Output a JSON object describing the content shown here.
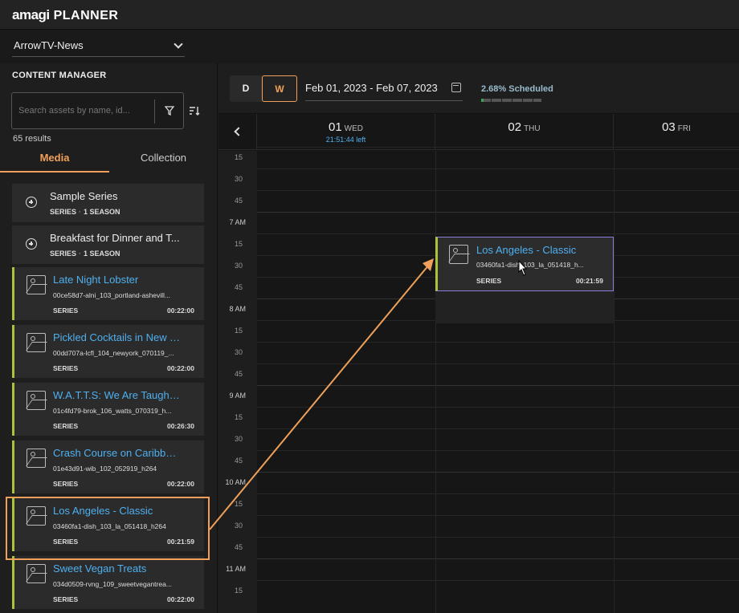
{
  "app": {
    "logo_brand": "amagi",
    "logo_product": "PLANNER",
    "channel": "ArrowTV-News"
  },
  "content_manager": {
    "title": "CONTENT MANAGER",
    "search_placeholder": "Search assets by name, id...",
    "results": "65 results",
    "tabs": {
      "media": "Media",
      "collection": "Collection"
    },
    "series": [
      {
        "title": "Sample Series",
        "type": "SERIES",
        "seasons": "1 SEASON"
      },
      {
        "title": "Breakfast for Dinner and T...",
        "type": "SERIES",
        "seasons": "1 SEASON"
      }
    ],
    "assets": [
      {
        "title": "Late Night Lobster",
        "file": "00ce58d7-alni_103_portland-ashevill...",
        "type": "SERIES",
        "duration": "00:22:00"
      },
      {
        "title": "Pickled Cocktails in New Y...",
        "file": "00dd707a-lcfl_104_newyork_070119_...",
        "type": "SERIES",
        "duration": "00:22:00"
      },
      {
        "title": "W.A.T.T.S: We Are Taught ...",
        "file": "01c4fd79-brok_106_watts_070319_h...",
        "type": "SERIES",
        "duration": "00:26:30"
      },
      {
        "title": "Crash Course on Caribbea...",
        "file": "01e43d91-wib_102_052919_h264",
        "type": "SERIES",
        "duration": "00:22:00"
      },
      {
        "title": "Los Angeles - Classic",
        "file": "03460fa1-dish_103_la_051418_h264",
        "type": "SERIES",
        "duration": "00:21:59"
      },
      {
        "title": "Sweet Vegan Treats",
        "file": "034d0509-rvng_109_sweetvegantrea...",
        "type": "SERIES",
        "duration": "00:22:00"
      }
    ]
  },
  "planner": {
    "view_day": "D",
    "view_week": "W",
    "date_range": "Feb 01, 2023 - Feb 07, 2023",
    "scheduled": "2.68% Scheduled",
    "scheduled_fraction": 0.0268,
    "days": [
      {
        "num": "01",
        "name": "WED",
        "left": "21:51:44 left"
      },
      {
        "num": "02",
        "name": "THU",
        "left": ""
      },
      {
        "num": "03",
        "name": "FRI",
        "left": ""
      }
    ],
    "time_labels": [
      "15",
      "30",
      "45",
      "7 AM",
      "15",
      "30",
      "45",
      "8 AM",
      "15",
      "30",
      "45",
      "9 AM",
      "15",
      "30",
      "45",
      "10 AM",
      "15",
      "30",
      "45",
      "11 AM",
      "15"
    ],
    "event": {
      "title": "Los Angeles - Classic",
      "file": "03460fa1-dish_103_la_051418_h...",
      "type": "SERIES",
      "duration": "00:21:59"
    }
  },
  "colors": {
    "accent": "#f0a05a",
    "link": "#4fb0f0",
    "series_bar": "#a8c43a"
  }
}
